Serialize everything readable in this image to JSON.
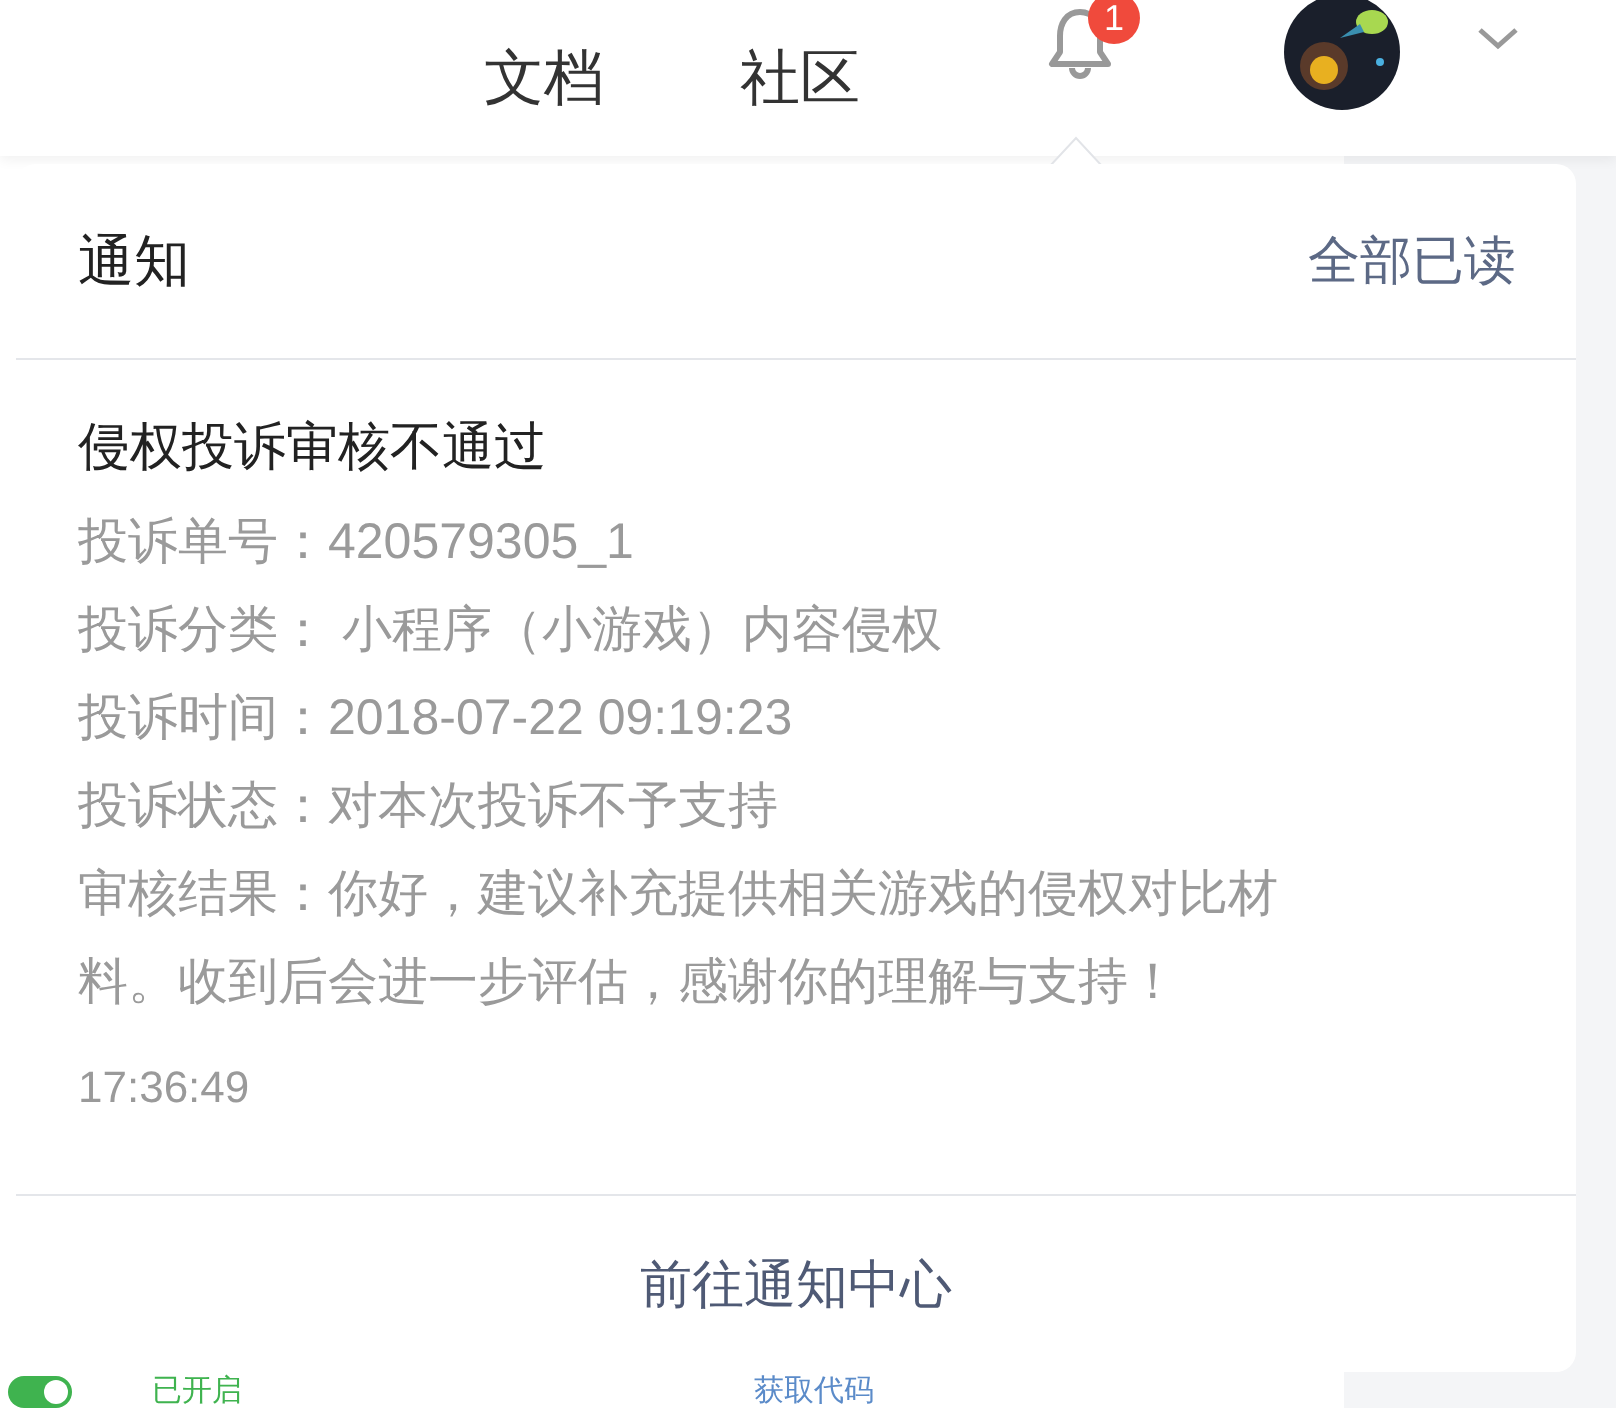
{
  "header": {
    "nav": [
      {
        "label": "文档"
      },
      {
        "label": "社区"
      }
    ],
    "notification_badge": "1"
  },
  "notification_panel": {
    "title": "通知",
    "mark_all_read": "全部已读",
    "notifications": [
      {
        "title": "侵权投诉审核不通过",
        "lines": [
          "投诉单号：420579305_1",
          "投诉分类： 小程序（小游戏）内容侵权",
          "投诉时间：2018-07-22 09:19:23",
          "投诉状态：对本次投诉不予支持",
          "审核结果：你好，建议补充提供相关游戏的侵权对比材料。收到后会进一步评估，感谢你的理解与支持！"
        ],
        "time": "17:36:49"
      }
    ],
    "footer_link": "前往通知中心"
  },
  "background": {
    "toggle": {
      "on": true,
      "label": "已开启"
    },
    "link": "获取代码"
  }
}
